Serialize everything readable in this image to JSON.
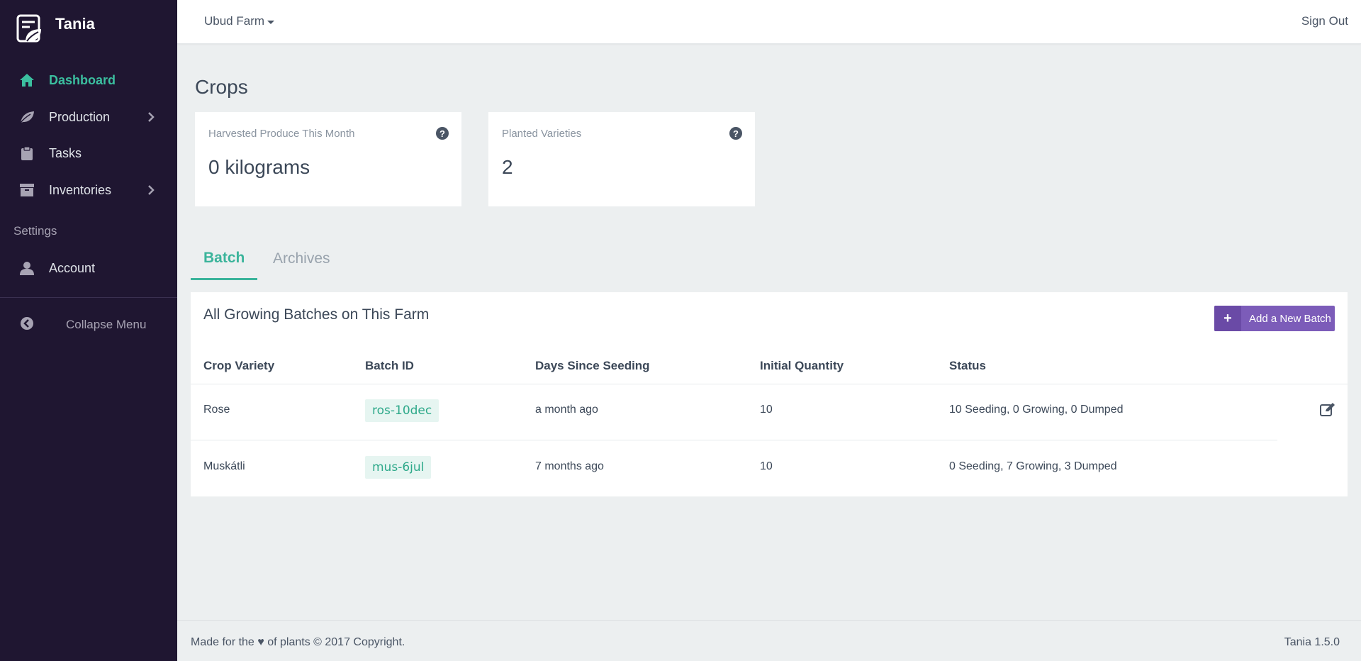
{
  "sidebar": {
    "brand": "Tania",
    "items": [
      {
        "label": "Dashboard",
        "icon": "home-icon"
      },
      {
        "label": "Production",
        "icon": "leaf-icon"
      },
      {
        "label": "Tasks",
        "icon": "clipboard-icon"
      },
      {
        "label": "Inventories",
        "icon": "archive-icon"
      }
    ],
    "settings_label": "Settings",
    "account_label": "Account",
    "collapse_label": "Collapse Menu"
  },
  "header": {
    "farm": "Ubud Farm",
    "sign_out": "Sign Out"
  },
  "main": {
    "title": "Crops",
    "cards": [
      {
        "label": "Harvested Produce This Month",
        "value": "0 kilograms"
      },
      {
        "label": "Planted Varieties",
        "value": "2"
      }
    ],
    "tabs": [
      {
        "label": "Batch",
        "active": true
      },
      {
        "label": "Archives",
        "active": false
      }
    ],
    "panel": {
      "title": "All Growing Batches on This Farm",
      "add_button": "Add a New Batch",
      "columns": [
        "Crop Variety",
        "Batch ID",
        "Days Since Seeding",
        "Initial Quantity",
        "Status"
      ],
      "rows": [
        {
          "variety": "Rose",
          "batch_id": "ros-10dec",
          "days": "a month ago",
          "quantity": "10",
          "status": "10 Seeding, 0 Growing, 0 Dumped"
        },
        {
          "variety": "Muskátli",
          "batch_id": "mus-6jul",
          "days": "7 months ago",
          "quantity": "10",
          "status": "0 Seeding, 7 Growing, 3 Dumped"
        }
      ]
    }
  },
  "footer": {
    "left": "Made for the ♥ of plants © 2017 Copyright.",
    "right": "Tania 1.5.0"
  },
  "colors": {
    "sidebar_bg": "#1f1631",
    "accent": "#3bb49b",
    "button": "#7c5cb9"
  }
}
